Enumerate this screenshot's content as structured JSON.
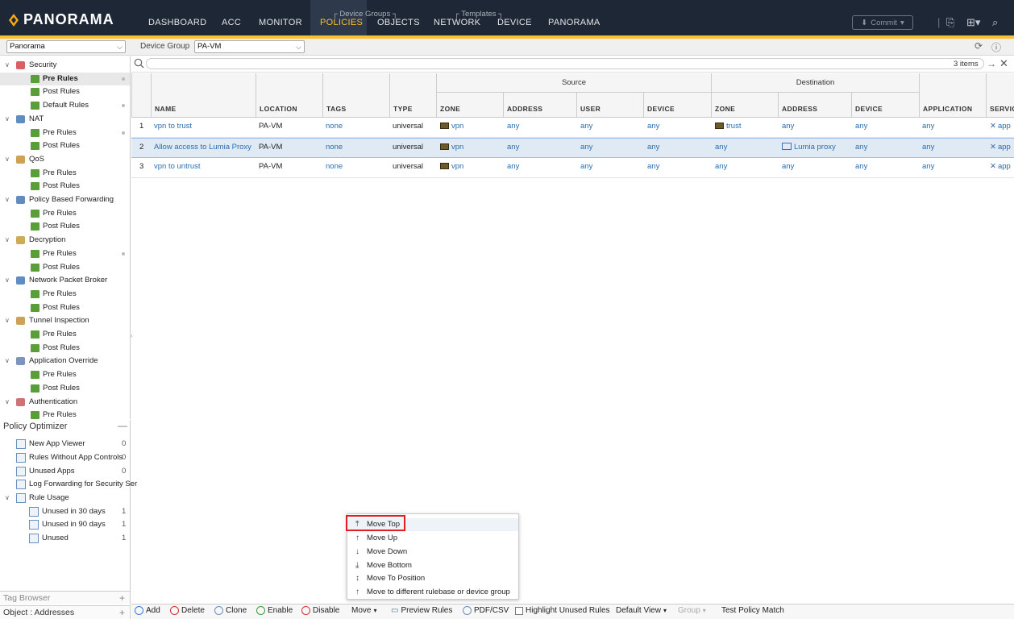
{
  "app": {
    "logo_text": "PANORAMA"
  },
  "nav": {
    "items": [
      "DASHBOARD",
      "ACC",
      "MONITOR",
      "POLICIES",
      "OBJECTS",
      "NETWORK",
      "DEVICE",
      "PANORAMA"
    ],
    "active": "POLICIES",
    "group_device_groups": "Device Groups",
    "group_templates": "Templates",
    "commit_label": "Commit",
    "accent_color": "#fbc02d"
  },
  "toolbar": {
    "context_select": "Panorama",
    "device_group_label": "Device Group",
    "device_group_value": "PA-VM"
  },
  "sidebar": {
    "sections": [
      {
        "label": "Security",
        "items": [
          "Pre Rules",
          "Post Rules",
          "Default Rules"
        ]
      },
      {
        "label": "NAT",
        "items": [
          "Pre Rules",
          "Post Rules"
        ]
      },
      {
        "label": "QoS",
        "items": [
          "Pre Rules",
          "Post Rules"
        ]
      },
      {
        "label": "Policy Based Forwarding",
        "items": [
          "Pre Rules",
          "Post Rules"
        ]
      },
      {
        "label": "Decryption",
        "items": [
          "Pre Rules",
          "Post Rules"
        ]
      },
      {
        "label": "Network Packet Broker",
        "items": [
          "Pre Rules",
          "Post Rules"
        ]
      },
      {
        "label": "Tunnel Inspection",
        "items": [
          "Pre Rules",
          "Post Rules"
        ]
      },
      {
        "label": "Application Override",
        "items": [
          "Pre Rules",
          "Post Rules"
        ]
      },
      {
        "label": "Authentication",
        "items": [
          "Pre Rules"
        ]
      }
    ],
    "selected": "Security / Pre Rules"
  },
  "optimizer": {
    "title": "Policy Optimizer",
    "items": [
      {
        "label": "New App Viewer",
        "count": "0"
      },
      {
        "label": "Rules Without App Controls",
        "count": "0"
      },
      {
        "label": "Unused Apps",
        "count": "0"
      },
      {
        "label": "Log Forwarding for Security Ser",
        "count": ""
      },
      {
        "label": "Rule Usage",
        "count": ""
      },
      {
        "label": "Unused in 30 days",
        "count": "1"
      },
      {
        "label": "Unused in 90 days",
        "count": "1"
      },
      {
        "label": "Unused",
        "count": "1"
      }
    ],
    "tag_browser": "Tag Browser",
    "object_browser": "Object : Addresses"
  },
  "search": {
    "placeholder": "",
    "items_count": "3 items"
  },
  "table": {
    "group_source": "Source",
    "group_destination": "Destination",
    "columns": [
      "NAME",
      "LOCATION",
      "TAGS",
      "TYPE",
      "ZONE",
      "ADDRESS",
      "USER",
      "DEVICE",
      "ZONE",
      "ADDRESS",
      "DEVICE",
      "APPLICATION",
      "SERVIC"
    ],
    "rows": [
      {
        "num": "1",
        "name": "vpn to trust",
        "location": "PA-VM",
        "tags": "none",
        "type": "universal",
        "src_zone": "vpn",
        "src_addr": "any",
        "user": "any",
        "src_device": "any",
        "dst_zone": "trust",
        "dst_addr": "any",
        "dst_device": "any",
        "application": "any",
        "service": "app"
      },
      {
        "num": "2",
        "name": "Allow access to Lumia Proxy",
        "location": "PA-VM",
        "tags": "none",
        "type": "universal",
        "src_zone": "vpn",
        "src_addr": "any",
        "user": "any",
        "src_device": "any",
        "dst_zone": "any",
        "dst_addr": "Lumia proxy",
        "dst_device": "any",
        "application": "any",
        "service": "app"
      },
      {
        "num": "3",
        "name": "vpn to untrust",
        "location": "PA-VM",
        "tags": "none",
        "type": "universal",
        "src_zone": "vpn",
        "src_addr": "any",
        "user": "any",
        "src_device": "any",
        "dst_zone": "any",
        "dst_addr": "any",
        "dst_device": "any",
        "application": "any",
        "service": "app"
      }
    ]
  },
  "context_menu": {
    "items": [
      "Move Top",
      "Move Up",
      "Move Down",
      "Move Bottom",
      "Move To Position",
      "Move to different rulebase or device group"
    ]
  },
  "bottom": {
    "add": "Add",
    "delete": "Delete",
    "clone": "Clone",
    "enable": "Enable",
    "disable": "Disable",
    "move": "Move",
    "preview": "Preview Rules",
    "pdf": "PDF/CSV",
    "highlight": "Highlight Unused Rules",
    "view": "Default View",
    "group": "Group",
    "test": "Test Policy Match"
  }
}
